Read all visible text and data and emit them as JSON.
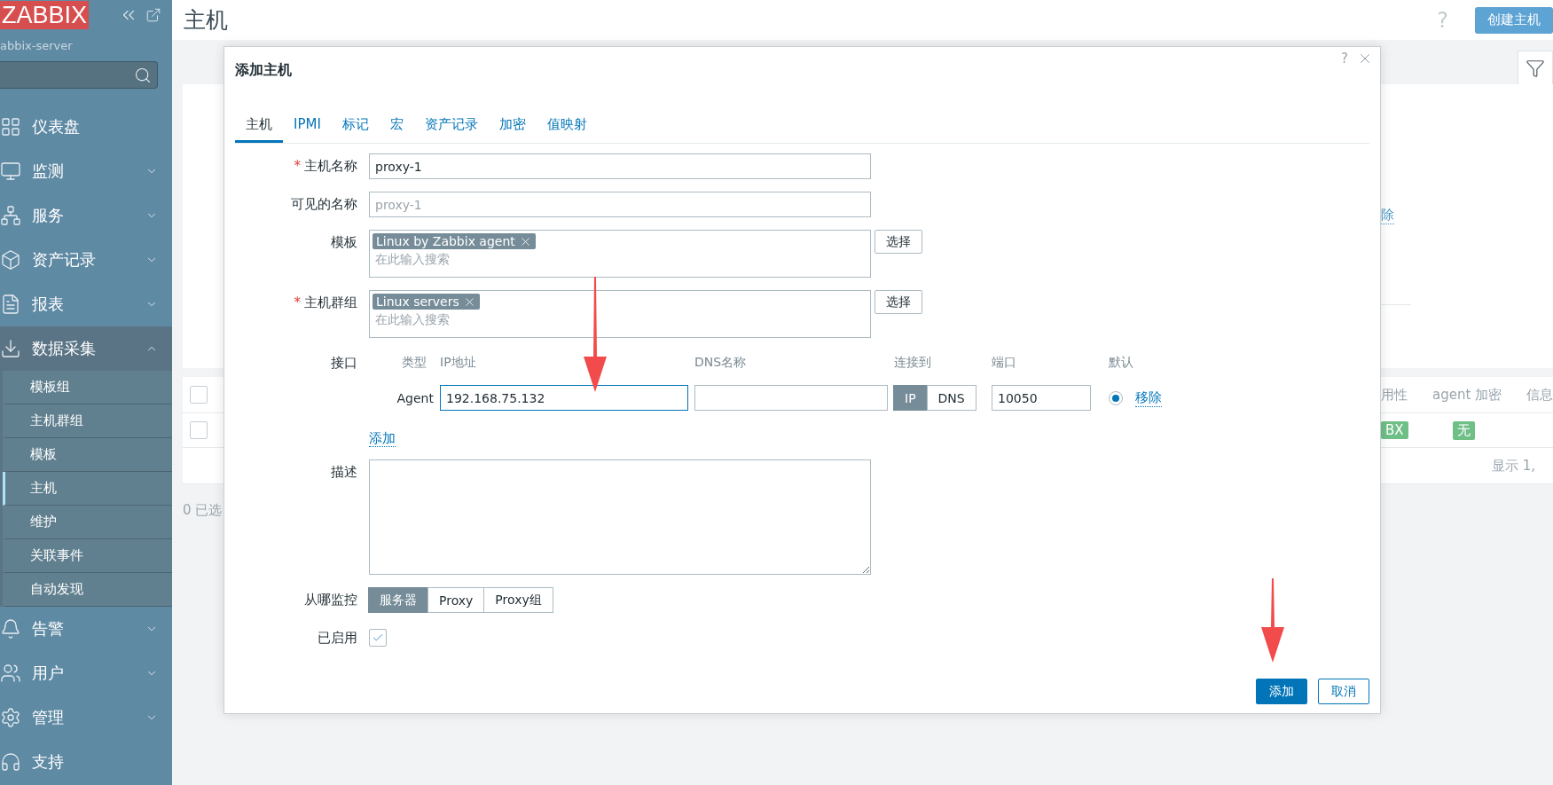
{
  "sidebar": {
    "logo": "ZABBIX",
    "server": "abbix-server",
    "menu": [
      {
        "label": "仪表盘",
        "kind": "link"
      },
      {
        "label": "监测",
        "kind": "group",
        "expanded": false
      },
      {
        "label": "服务",
        "kind": "group",
        "expanded": false
      },
      {
        "label": "资产记录",
        "kind": "group",
        "expanded": false
      },
      {
        "label": "报表",
        "kind": "group",
        "expanded": false
      },
      {
        "label": "数据采集",
        "kind": "group",
        "expanded": true,
        "children": [
          {
            "label": "模板组",
            "selected": false
          },
          {
            "label": "主机群组",
            "selected": false
          },
          {
            "label": "模板",
            "selected": false
          },
          {
            "label": "主机",
            "selected": true
          },
          {
            "label": "维护",
            "selected": false
          },
          {
            "label": "关联事件",
            "selected": false
          },
          {
            "label": "自动发现",
            "selected": false
          }
        ]
      },
      {
        "label": "告警",
        "kind": "group",
        "expanded": false
      },
      {
        "label": "用户",
        "kind": "group",
        "expanded": false
      },
      {
        "label": "管理",
        "kind": "group",
        "expanded": false
      },
      {
        "label": "支持",
        "kind": "link"
      }
    ]
  },
  "header": {
    "title": "主机",
    "help": "?",
    "create_button": "创建主机"
  },
  "background": {
    "filter_link": "除",
    "header_checked": false,
    "row_checked": false,
    "columns": [
      "用性",
      "agent 加密",
      "信息"
    ],
    "row_tags": [
      {
        "label": "BX",
        "color": "#6fbf87"
      },
      {
        "label": "无",
        "color": "#6fbf87"
      }
    ],
    "paging": "显示 1,",
    "selected_count": "0 已选"
  },
  "dialog": {
    "title": "添加主机",
    "help": "?",
    "required_mark": "*",
    "tabs": [
      {
        "label": "主机",
        "selected": true
      },
      {
        "label": "IPMI",
        "selected": false
      },
      {
        "label": "标记",
        "selected": false
      },
      {
        "label": "宏",
        "selected": false
      },
      {
        "label": "资产记录",
        "selected": false
      },
      {
        "label": "加密",
        "selected": false
      },
      {
        "label": "值映射",
        "selected": false
      }
    ],
    "fields": [
      {
        "kind": "text",
        "label": "主机名称",
        "required": true,
        "value": "proxy-1"
      },
      {
        "kind": "text",
        "label": "可见的名称",
        "required": false,
        "placeholder": "proxy-1"
      },
      {
        "kind": "multiselect",
        "label": "模板",
        "required": false,
        "tags": [
          "Linux by Zabbix agent"
        ],
        "placeholder": "在此输入搜索",
        "button": "选择"
      },
      {
        "kind": "multiselect",
        "label": "主机群组",
        "required": true,
        "tags": [
          "Linux servers"
        ],
        "placeholder": "在此输入搜索",
        "button": "选择"
      },
      {
        "kind": "interfaces",
        "label": "接口",
        "required": false,
        "columns": [
          "类型",
          "IP地址",
          "DNS名称",
          "连接到",
          "端口",
          "默认"
        ],
        "rows": [
          {
            "type": "Agent",
            "ip": "192.168.75.132",
            "focused": true,
            "connect": [
              {
                "label": "IP",
                "selected": true
              },
              {
                "label": "DNS",
                "selected": false
              }
            ],
            "port": "10050",
            "default": true,
            "remove": "移除"
          }
        ],
        "add": "添加"
      },
      {
        "kind": "textarea",
        "label": "描述",
        "required": false
      },
      {
        "kind": "segmented",
        "label": "从哪监控",
        "required": false,
        "options": [
          {
            "label": "服务器",
            "selected": true
          },
          {
            "label": "Proxy",
            "selected": false
          },
          {
            "label": "Proxy组",
            "selected": false
          }
        ]
      },
      {
        "kind": "checkbox",
        "label": "已启用",
        "required": false,
        "checked": true
      }
    ],
    "buttons": [
      {
        "label": "添加",
        "primary": true
      },
      {
        "label": "取消",
        "primary": false
      }
    ]
  }
}
